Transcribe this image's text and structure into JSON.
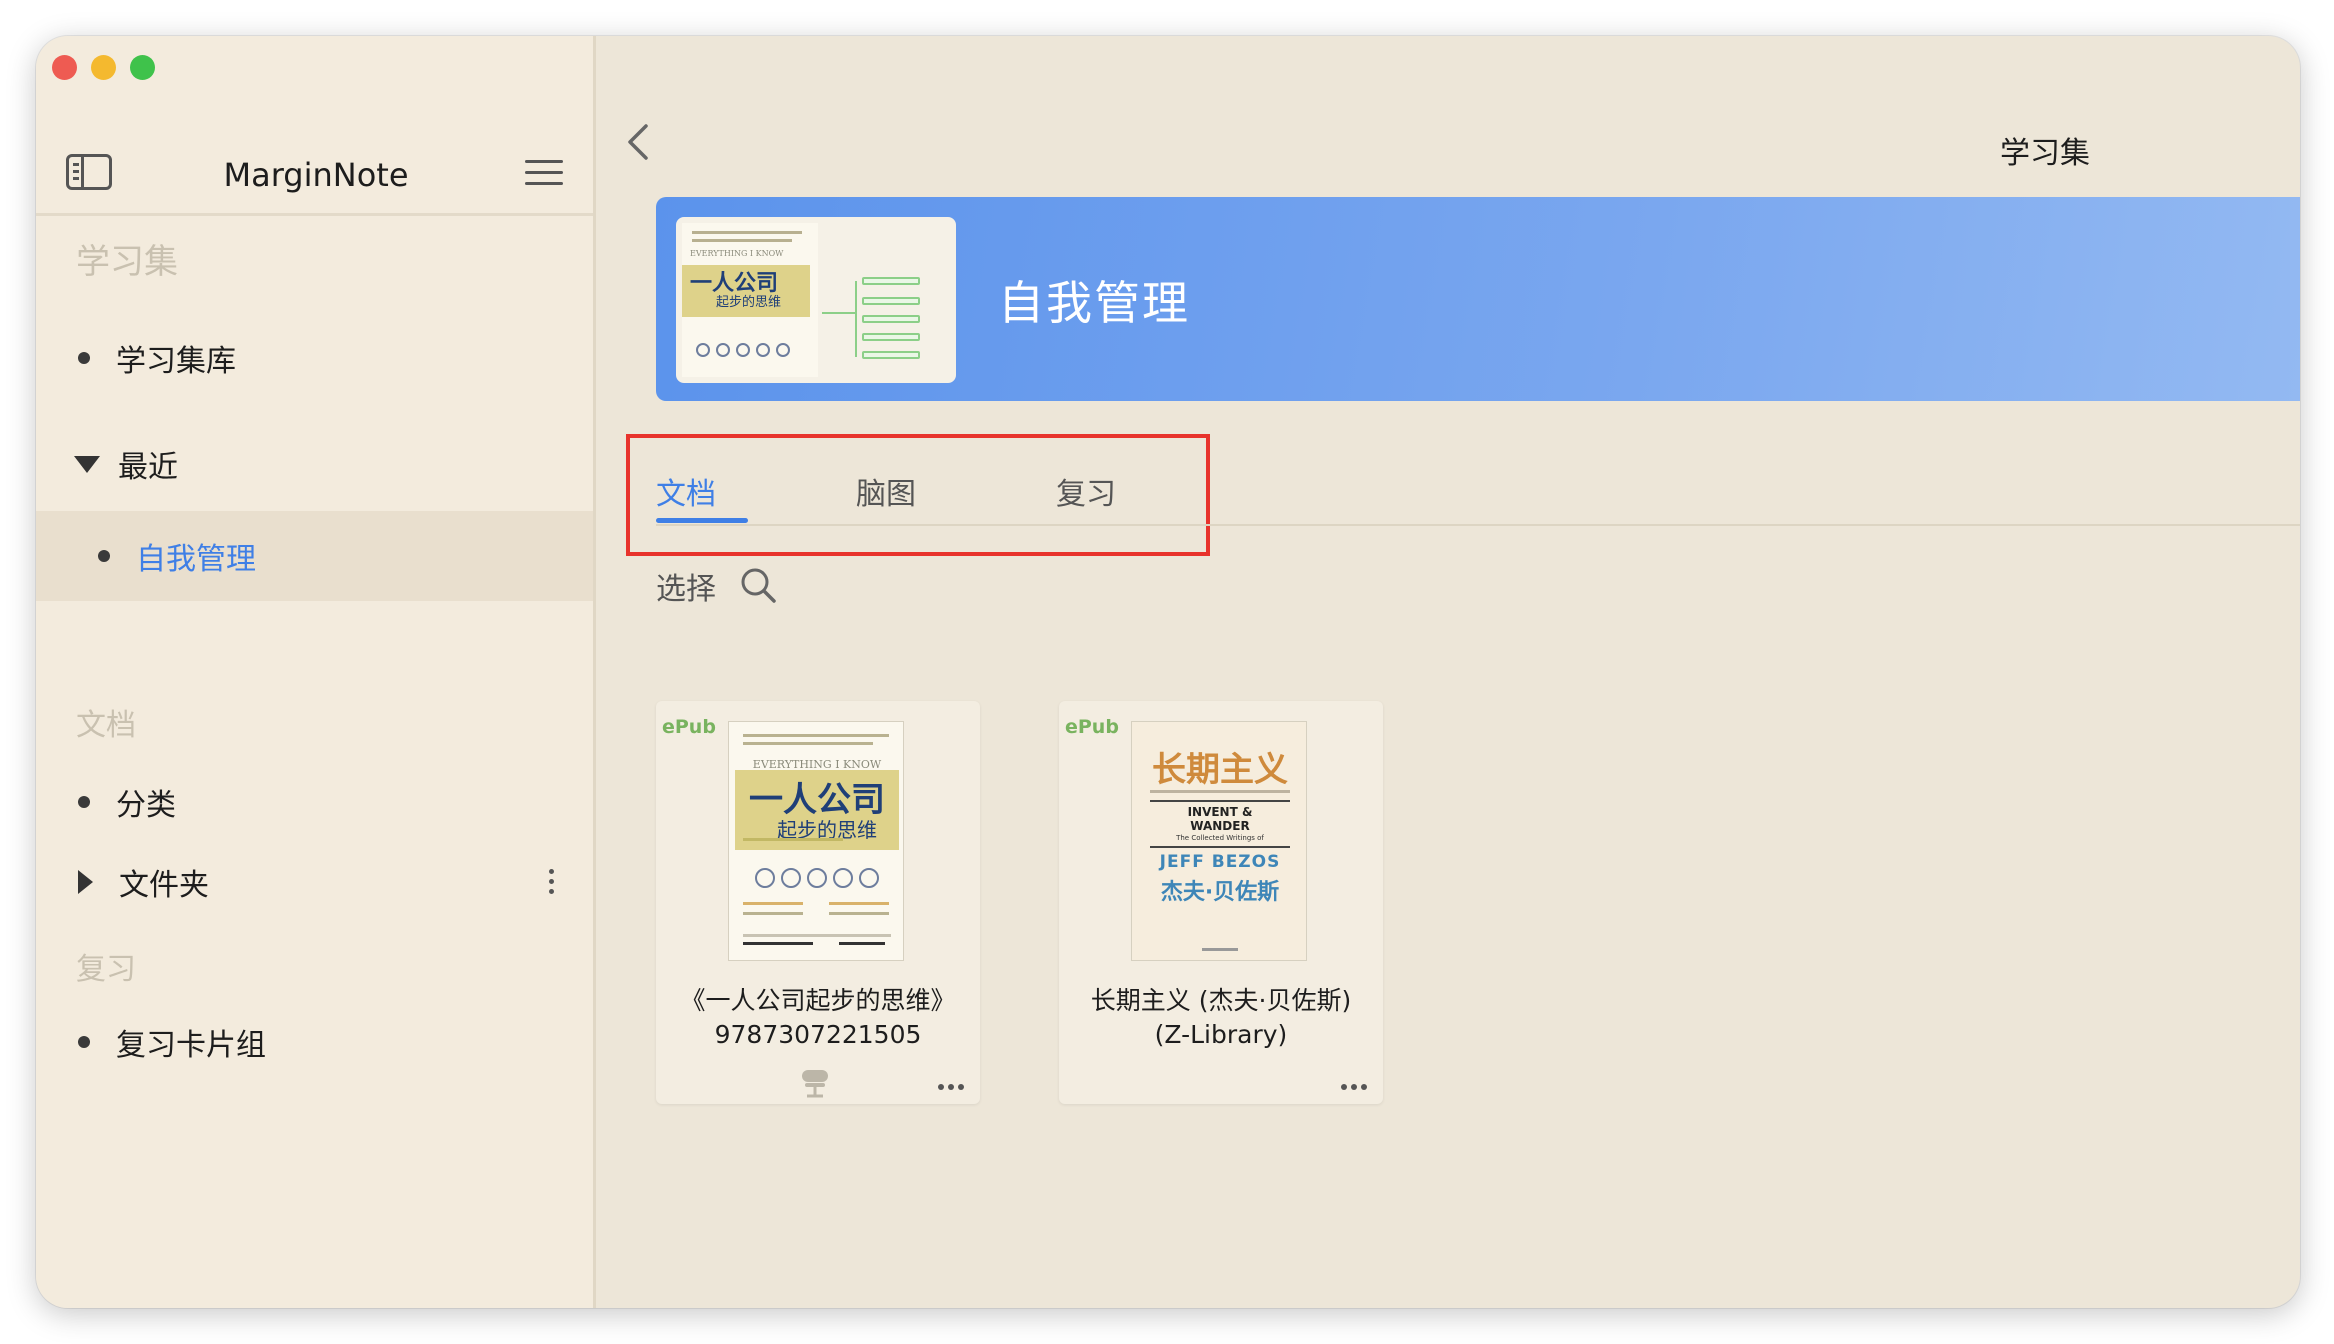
{
  "colors": {
    "accent": "#3f7fe6",
    "highlight_box": "#e8332c",
    "epub_badge": "#79b35f",
    "banner": "#5b93ec"
  },
  "sidebar": {
    "app_title": "MarginNote",
    "sections": {
      "notebooks": "学习集",
      "documents": "文档",
      "review": "复习"
    },
    "items": {
      "library": "学习集库",
      "recent": "最近",
      "recent_child": "自我管理",
      "categories": "分类",
      "folders": "文件夹",
      "flashcards": "复习卡片组"
    }
  },
  "main": {
    "header_title": "学习集",
    "banner_title": "自我管理",
    "banner_thumb": {
      "en_line": "EVERYTHING I KNOW",
      "title": "一人公司",
      "subtitle": "起步的思维"
    },
    "tabs": [
      "文档",
      "脑图",
      "复习"
    ],
    "active_tab": "文档",
    "select_label": "选择",
    "documents": [
      {
        "badge": "ePub",
        "title_line1": "《一人公司起步的思维》",
        "title_line2": "9787307221505",
        "cover": {
          "en_line": "EVERYTHING I KNOW",
          "title": "一人公司",
          "subtitle": "起步的思维"
        }
      },
      {
        "badge": "ePub",
        "title_line1": "长期主义 (杰夫·贝佐斯)",
        "title_line2": "(Z-Library)",
        "cover": {
          "title": "长期主义",
          "en_title_1": "INVENT &",
          "en_title_2": "WANDER",
          "en_sub": "The Collected Writings of",
          "author_en": "JEFF BEZOS",
          "author_cn": "杰夫·贝佐斯"
        }
      }
    ]
  }
}
